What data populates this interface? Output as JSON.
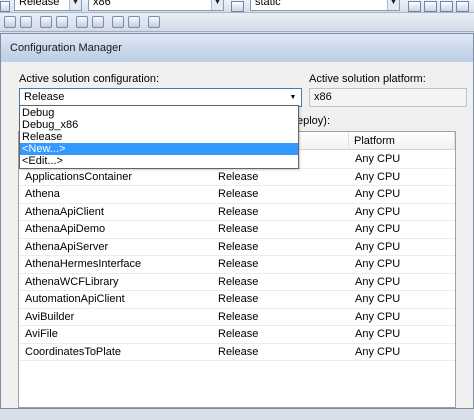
{
  "toolbar": {
    "config_value": "Release",
    "platform_value": "x86",
    "startup_value": "static"
  },
  "dialog": {
    "title": "Configuration Manager",
    "solution_config_label": "Active solution configuration:",
    "solution_config_value": "Release",
    "solution_platform_label": "Active solution platform:",
    "solution_platform_value": "x86",
    "project_contexts_label_tail": "eploy):"
  },
  "dropdown": {
    "options": [
      "Debug",
      "Debug_x86",
      "Release",
      "<New...>",
      "<Edit...>"
    ],
    "selected_index": 3
  },
  "grid": {
    "columns": [
      "",
      "",
      "Platform"
    ],
    "rows": [
      {
        "project": "",
        "configuration": "",
        "platform": "Any CPU"
      },
      {
        "project": "ApplicationsContainer",
        "configuration": "Release",
        "platform": "Any CPU"
      },
      {
        "project": "Athena",
        "configuration": "Release",
        "platform": "Any CPU"
      },
      {
        "project": "AthenaApiClient",
        "configuration": "Release",
        "platform": "Any CPU"
      },
      {
        "project": "AthenaApiDemo",
        "configuration": "Release",
        "platform": "Any CPU"
      },
      {
        "project": "AthenaApiServer",
        "configuration": "Release",
        "platform": "Any CPU"
      },
      {
        "project": "AthenaHermesInterface",
        "configuration": "Release",
        "platform": "Any CPU"
      },
      {
        "project": "AthenaWCFLibrary",
        "configuration": "Release",
        "platform": "Any CPU"
      },
      {
        "project": "AutomationApiClient",
        "configuration": "Release",
        "platform": "Any CPU"
      },
      {
        "project": "AviBuilder",
        "configuration": "Release",
        "platform": "Any CPU"
      },
      {
        "project": "AviFile",
        "configuration": "Release",
        "platform": "Any CPU"
      },
      {
        "project": "CoordinatesToPlate",
        "configuration": "Release",
        "platform": "Any CPU"
      }
    ]
  },
  "colors": {
    "selection": "#3399ff",
    "dialog_bg": "#f0f0f0",
    "titlebar": "#c9d8ea"
  }
}
